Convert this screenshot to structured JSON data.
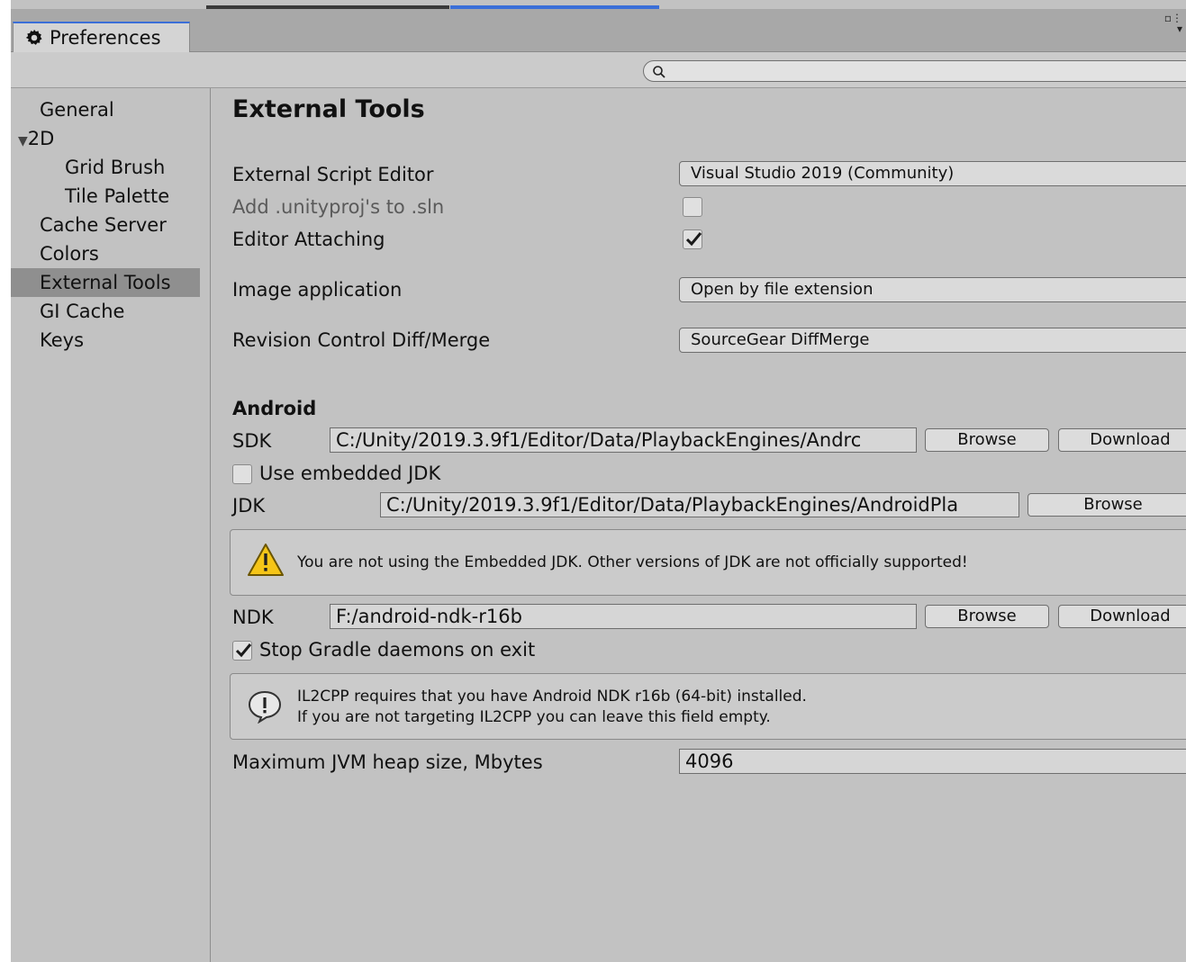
{
  "window": {
    "tab_title": "Preferences",
    "search": {
      "value": "",
      "placeholder": ""
    }
  },
  "sidebar": {
    "items": [
      {
        "label": "General"
      },
      {
        "label": "2D"
      },
      {
        "label": "Grid Brush"
      },
      {
        "label": "Tile Palette"
      },
      {
        "label": "Cache Server"
      },
      {
        "label": "Colors"
      },
      {
        "label": "External Tools",
        "selected": true
      },
      {
        "label": "GI Cache"
      },
      {
        "label": "Keys"
      }
    ]
  },
  "main": {
    "title": "External Tools",
    "script_editor": {
      "label": "External Script Editor",
      "value": "Visual Studio 2019 (Community)"
    },
    "add_unityproj": {
      "label": "Add .unityproj's to .sln",
      "checked": false
    },
    "editor_attaching": {
      "label": "Editor Attaching",
      "checked": true
    },
    "image_app": {
      "label": "Image application",
      "value": "Open by file extension"
    },
    "diff_merge": {
      "label": "Revision Control Diff/Merge",
      "value": "SourceGear DiffMerge"
    },
    "android": {
      "heading": "Android",
      "sdk": {
        "label": "SDK",
        "value": "C:/Unity/2019.3.9f1/Editor/Data/PlaybackEngines/Andrc",
        "browse": "Browse",
        "download": "Download"
      },
      "use_embedded_jdk": {
        "label": "Use embedded JDK",
        "checked": false
      },
      "jdk": {
        "label": "JDK",
        "value": "C:/Unity/2019.3.9f1/Editor/Data/PlaybackEngines/AndroidPla",
        "browse": "Browse"
      },
      "jdk_warning": "You are not using the Embedded JDK. Other versions of JDK are not officially supported!",
      "ndk": {
        "label": "NDK",
        "value": "F:/android-ndk-r16b",
        "browse": "Browse",
        "download": "Download"
      },
      "stop_gradle": {
        "label": "Stop Gradle daemons on exit",
        "checked": true
      },
      "ndk_info_line1": "IL2CPP requires that you have Android NDK r16b (64-bit) installed.",
      "ndk_info_line2": "If you are not targeting IL2CPP you can leave this field empty.",
      "jvm_heap": {
        "label": "Maximum JVM heap size, Mbytes",
        "value": "4096"
      }
    }
  },
  "colors": {
    "selection": "#8f8f8f",
    "panel": "#c2c2c2",
    "tab_accent": "#3b6fd8",
    "warning": "#f5c518"
  },
  "icons": {
    "tab": "gear-icon",
    "search": "search-icon",
    "warning": "warning-icon",
    "info": "info-icon",
    "tree_toggle": "triangle-down-icon"
  }
}
